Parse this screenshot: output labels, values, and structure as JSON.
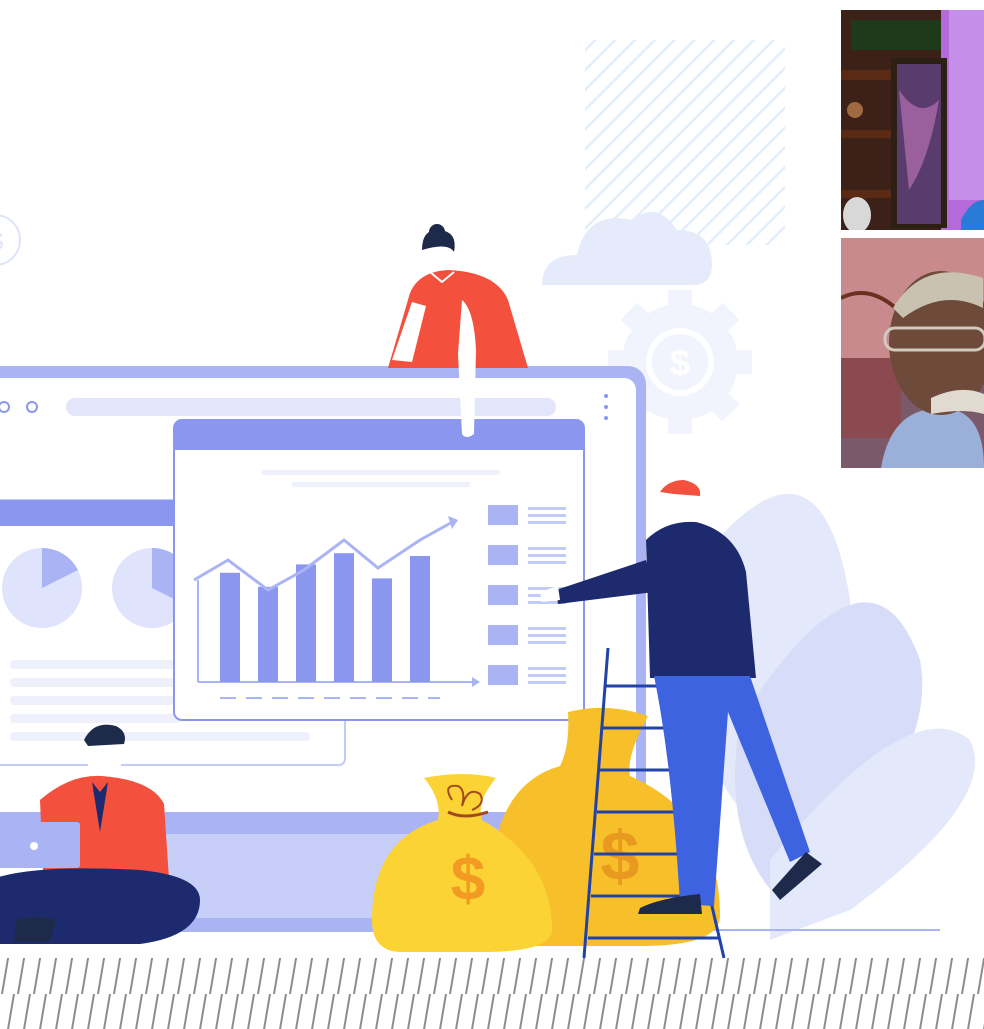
{
  "scene": {
    "description_icons": [
      "dollar-coin-icon",
      "gear-dollar-icon",
      "cloud-icon",
      "pie-chart-icon",
      "line-chart-icon",
      "money-bag-icon",
      "ladder-icon",
      "laptop-icon"
    ]
  },
  "browser_window": {
    "menu_icon": "kebab-menu-icon"
  },
  "chart_widget": {
    "bars": [
      0.78,
      0.68,
      0.84,
      0.92,
      0.74,
      0.9
    ]
  },
  "participants": [
    {
      "role": "video-participant-1"
    },
    {
      "role": "video-participant-2"
    }
  ],
  "colors": {
    "primary": "#8b97ee",
    "light": "#dfe3fb",
    "navy": "#1d2a6e",
    "red": "#f4503e",
    "gold": "#f7bf2a",
    "blue": "#3d63e0"
  }
}
